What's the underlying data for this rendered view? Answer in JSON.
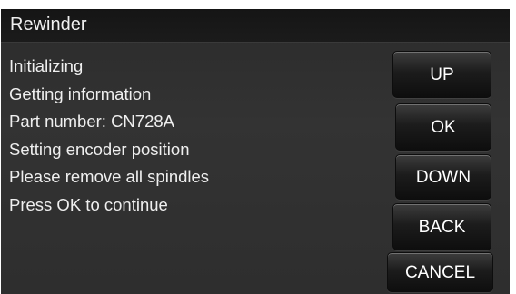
{
  "window": {
    "title": "Rewinder"
  },
  "messages": [
    "Initializing",
    "Getting information",
    "Part number: CN728A",
    "Setting encoder position",
    "Please remove all spindles",
    "Press OK to continue"
  ],
  "buttons": {
    "up": "UP",
    "ok": "OK",
    "down": "DOWN",
    "back": "BACK",
    "cancel": "CANCEL"
  },
  "colors": {
    "panel_background": "#2e2e2e",
    "title_bar_background": "#181818",
    "text": "#efefef",
    "page_background": "#ffffff"
  }
}
